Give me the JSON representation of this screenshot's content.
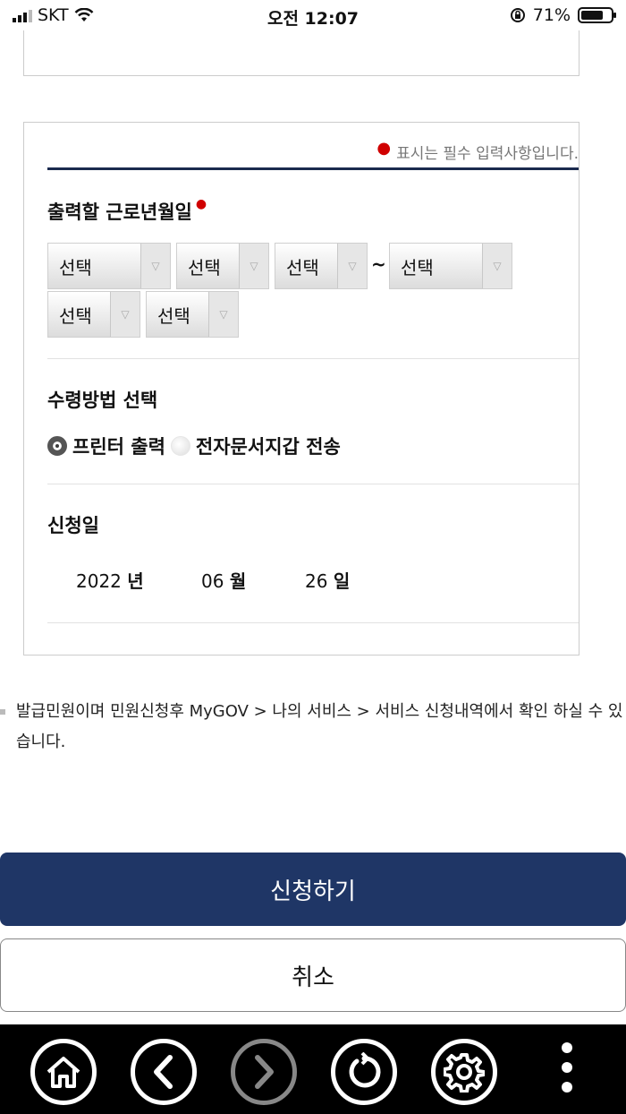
{
  "status_bar": {
    "carrier": "SKT",
    "time": "오전 12:07",
    "battery": "71%"
  },
  "form": {
    "required_note": "표시는 필수 입력사항입니다.",
    "work_period": {
      "title": "출력할 근로년월일",
      "selects": [
        "선택",
        "선택",
        "선택",
        "선택",
        "선택",
        "선택"
      ],
      "separator": "~"
    },
    "receive_method": {
      "title": "수령방법 선택",
      "options": [
        {
          "label": "프린터 출력",
          "selected": true
        },
        {
          "label": "전자문서지갑 전송",
          "selected": false
        }
      ]
    },
    "apply_date": {
      "title": "신청일",
      "year": "2022",
      "year_unit": "년",
      "month": "06",
      "month_unit": "월",
      "day": "26",
      "day_unit": "일"
    }
  },
  "info_text": "발급민원이며 민원신청후 MyGOV > 나의 서비스 > 서비스 신청내역에서 확인 하실 수 있습니다.",
  "buttons": {
    "apply": "신청하기",
    "cancel": "취소"
  },
  "toolbar": {
    "icons": [
      "home-icon",
      "back-icon",
      "forward-icon",
      "refresh-icon",
      "settings-icon",
      "more-icon"
    ]
  },
  "colors": {
    "accent": "#1f3666",
    "required": "#d00000",
    "navy_line": "#1b2a4e"
  }
}
